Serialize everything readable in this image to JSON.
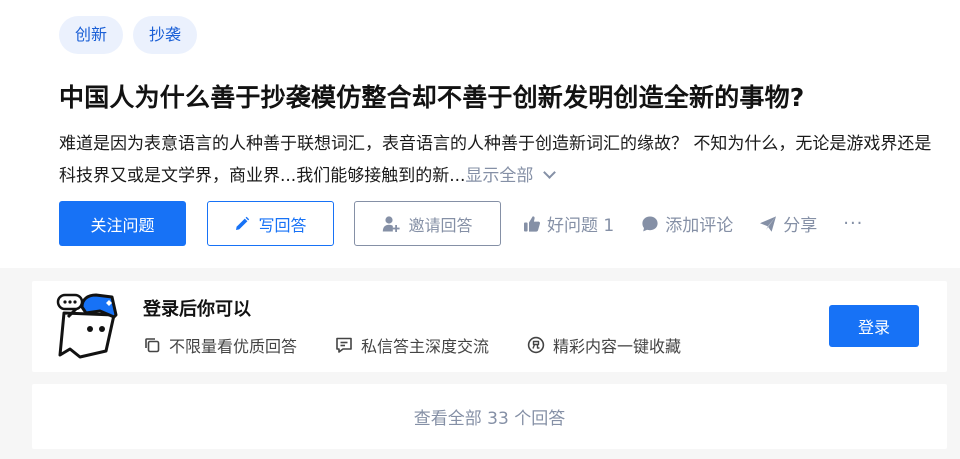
{
  "topics": [
    "创新",
    "抄袭"
  ],
  "question": {
    "title": "中国人为什么善于抄袭模仿整合却不善于创新发明创造全新的事物?",
    "excerpt": "难道是因为表意语言的人种善于联想词汇，表音语言的人种善于创造新词汇的缘故？ 不知为什么，无论是游戏界还是科技界又或是文学界，商业界...我们能够接触到的新...",
    "show_all": "显示全部"
  },
  "actions": {
    "follow": "关注问题",
    "write": "写回答",
    "invite": "邀请回答",
    "good_question": "好问题 1",
    "comment": "添加评论",
    "share": "分享",
    "more": "···"
  },
  "login_prompt": {
    "title": "登录后你可以",
    "features": [
      "不限量看优质回答",
      "私信答主深度交流",
      "精彩内容一键收藏"
    ],
    "button": "登录"
  },
  "view_all": "查看全部 33 个回答",
  "colors": {
    "primary": "#1772f6",
    "muted": "#8590a6",
    "topic_bg": "#ebf1fd",
    "page_bg": "#f6f6f6"
  }
}
